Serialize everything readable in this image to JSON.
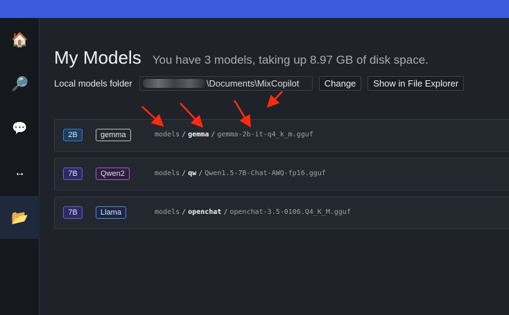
{
  "sidebar": {
    "items": [
      {
        "icon": "home-icon",
        "glyph": "🏠"
      },
      {
        "icon": "search-icon",
        "glyph": "🔎"
      },
      {
        "icon": "chat-icon",
        "glyph": "💬"
      },
      {
        "icon": "swap-icon",
        "glyph": "↔"
      },
      {
        "icon": "folder-icon",
        "glyph": "📂"
      }
    ]
  },
  "header": {
    "title": "My Models",
    "subtitle": "You have 3 models, taking up 8.97 GB of disk space."
  },
  "folder": {
    "label": "Local models folder",
    "path": "\\Documents\\MixCopilot",
    "change_label": "Change",
    "explorer_label": "Show in File Explorer"
  },
  "models": [
    {
      "size": "2B",
      "family": "gemma",
      "dir": "models",
      "org": "gemma",
      "file": "gemma-2b-it-q4_k_m.gguf"
    },
    {
      "size": "7B",
      "family": "Qwen2",
      "dir": "models",
      "org": "qw",
      "file": "Qwen1.5-7B-Chat-AWQ-fp16.gguf"
    },
    {
      "size": "7B",
      "family": "Llama",
      "dir": "models",
      "org": "openchat",
      "file": "openchat-3.5-0106.Q4_K_M.gguf"
    }
  ],
  "colors": {
    "topbar": "#3b5bdb",
    "badge_2b_bg": "#1f3d5c",
    "badge_2b_border": "#2f7fd0",
    "badge_7b_bg": "#2c2a63",
    "badge_7b_border": "#6b63d9",
    "gemma_border": "#bfc3c8",
    "qwen_border": "#a45cd6",
    "llama_border": "#4f86d8",
    "annotation_arrow": "#ff2a0f"
  }
}
